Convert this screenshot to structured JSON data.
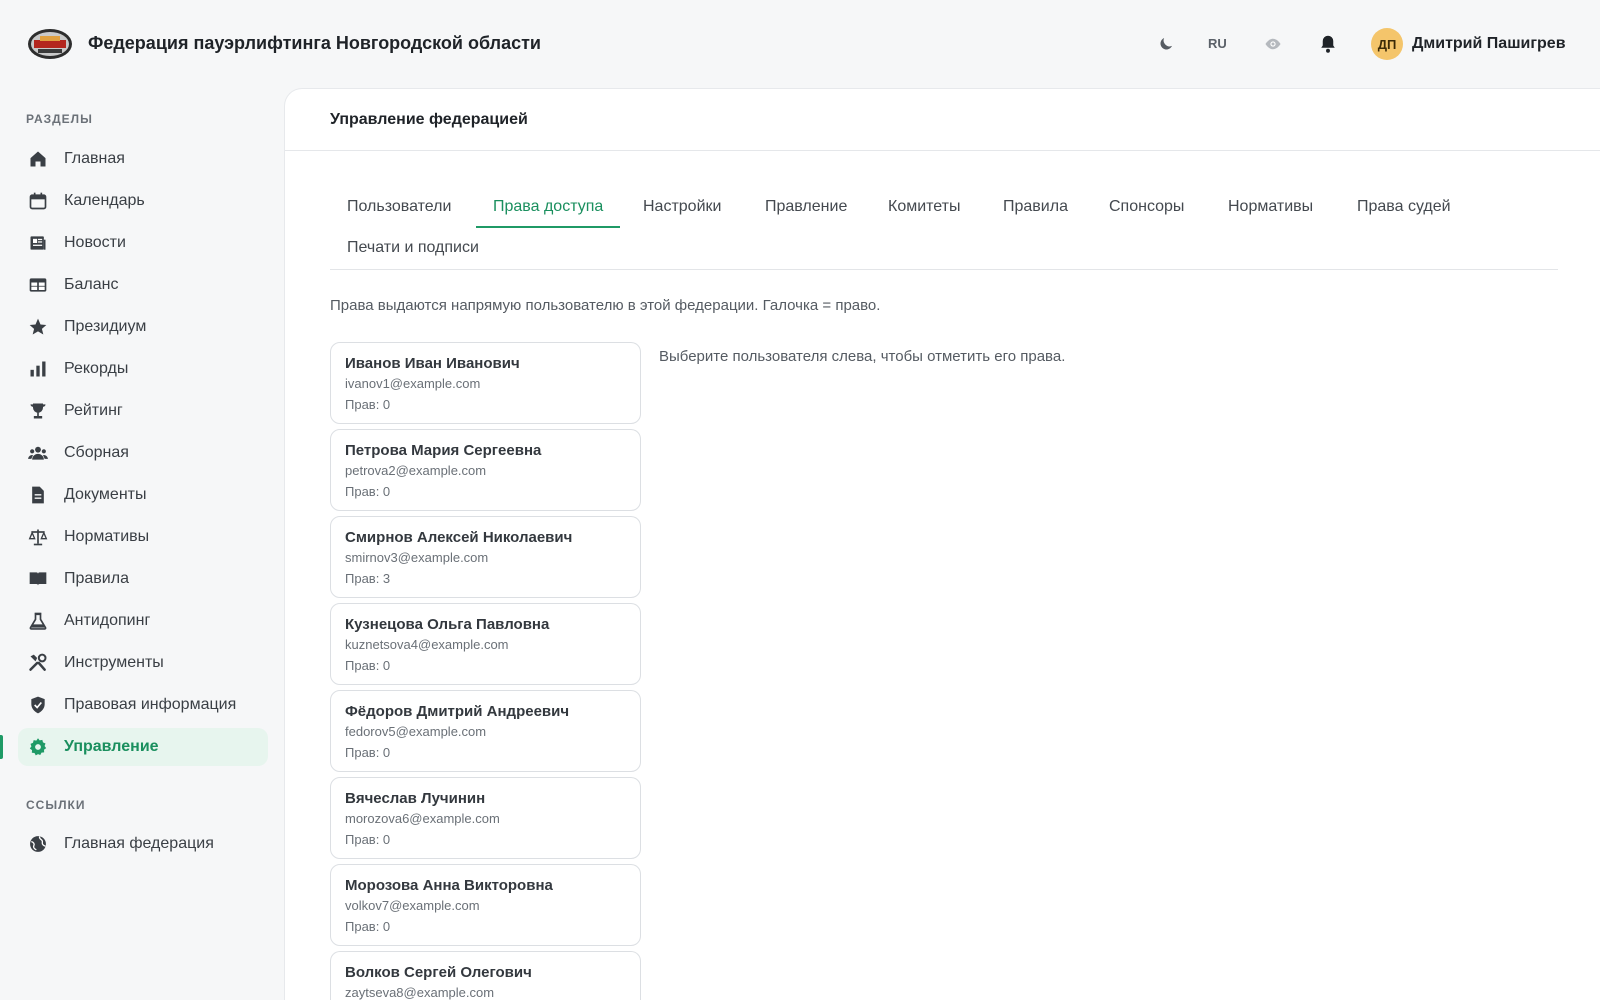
{
  "header": {
    "logo_icon": "federation-logo",
    "title": "Федерация пауэрлифтинга Новгородской области",
    "theme_icon": "moon-icon",
    "language": "RU",
    "view_icon": "eye-icon",
    "notifications_icon": "bell-icon",
    "user_initials": "ДП",
    "user_name": "Дмитрий Пашигрев"
  },
  "sidebar": {
    "sections_title": "РАЗДЕЛЫ",
    "items": [
      {
        "label": "Главная",
        "icon": "home-icon"
      },
      {
        "label": "Календарь",
        "icon": "calendar-icon"
      },
      {
        "label": "Новости",
        "icon": "newspaper-icon"
      },
      {
        "label": "Баланс",
        "icon": "table-icon"
      },
      {
        "label": "Президиум",
        "icon": "star-icon"
      },
      {
        "label": "Рекорды",
        "icon": "bar-chart-icon"
      },
      {
        "label": "Рейтинг",
        "icon": "trophy-icon"
      },
      {
        "label": "Сборная",
        "icon": "users-icon"
      },
      {
        "label": "Документы",
        "icon": "document-icon"
      },
      {
        "label": "Нормативы",
        "icon": "scales-icon"
      },
      {
        "label": "Правила",
        "icon": "book-icon"
      },
      {
        "label": "Антидопинг",
        "icon": "flask-icon"
      },
      {
        "label": "Инструменты",
        "icon": "tools-icon"
      },
      {
        "label": "Правовая информация",
        "icon": "shield-icon"
      },
      {
        "label": "Управление",
        "icon": "gear-icon",
        "active": true
      }
    ],
    "links_title": "ССЫЛКИ",
    "links": [
      {
        "label": "Главная федерация",
        "icon": "globe-icon"
      }
    ]
  },
  "main": {
    "title": "Управление федерацией",
    "tabs": [
      {
        "label": "Пользователи"
      },
      {
        "label": "Права доступа",
        "active": true
      },
      {
        "label": "Настройки"
      },
      {
        "label": "Правление"
      },
      {
        "label": "Комитеты"
      },
      {
        "label": "Правила"
      },
      {
        "label": "Спонсоры"
      },
      {
        "label": "Нормативы"
      },
      {
        "label": "Права судей"
      },
      {
        "label": "Печати и подписи"
      }
    ],
    "hint": "Права выдаются напрямую пользователю в этой федерации. Галочка = право.",
    "select_message": "Выберите пользователя слева, чтобы отметить его права.",
    "users": [
      {
        "name": "Иванов Иван Иванович",
        "email": "ivanov1@example.com",
        "rights": "Прав: 0"
      },
      {
        "name": "Петрова Мария Сергеевна",
        "email": "petrova2@example.com",
        "rights": "Прав: 0"
      },
      {
        "name": "Смирнов Алексей Николаевич",
        "email": "smirnov3@example.com",
        "rights": "Прав: 3"
      },
      {
        "name": "Кузнецова Ольга Павловна",
        "email": "kuznetsova4@example.com",
        "rights": "Прав: 0"
      },
      {
        "name": "Фёдоров Дмитрий Андреевич",
        "email": "fedorov5@example.com",
        "rights": "Прав: 0"
      },
      {
        "name": "Вячеслав Лучинин",
        "email": "morozova6@example.com",
        "rights": "Прав: 0"
      },
      {
        "name": "Морозова Анна Викторовна",
        "email": "volkov7@example.com",
        "rights": "Прав: 0"
      },
      {
        "name": "Волков Сергей Олегович",
        "email": "zaytseva8@example.com",
        "rights": ""
      }
    ]
  },
  "colors": {
    "accent": "#1f9a66",
    "active_bg": "#e7f5ee",
    "avatar_bg": "#f4c56b"
  }
}
